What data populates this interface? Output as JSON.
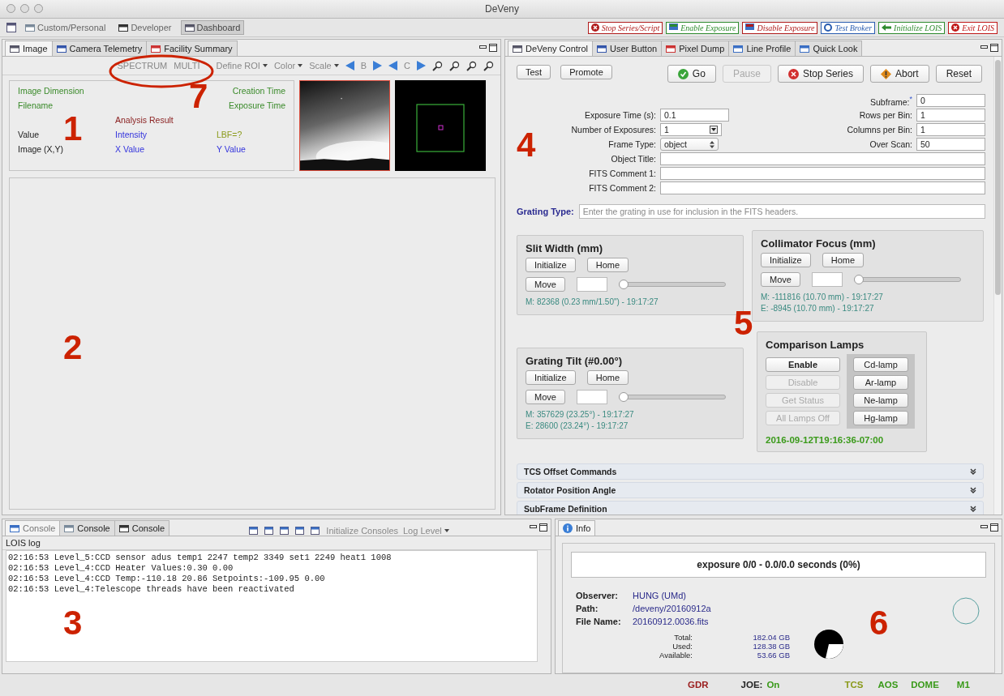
{
  "window": {
    "title": "DeVeny"
  },
  "perspectives": [
    {
      "label": "Custom/Personal",
      "selected": false
    },
    {
      "label": "Developer",
      "selected": false
    },
    {
      "label": "Dashboard",
      "selected": true
    }
  ],
  "command_buttons": [
    {
      "label": "Stop Series/Script",
      "color": "#b01c1c",
      "kind": "stop"
    },
    {
      "label": "Enable Exposure",
      "color": "#2e8b2e",
      "kind": "enable"
    },
    {
      "label": "Disable Exposure",
      "color": "#b01c1c",
      "kind": "disable"
    },
    {
      "label": "Test Broker",
      "color": "#2a5db0",
      "kind": "broker"
    },
    {
      "label": "Initialize LOIS",
      "color": "#2e8b2e",
      "kind": "init"
    },
    {
      "label": "Exit LOIS",
      "color": "#c01818",
      "kind": "exit"
    }
  ],
  "image_panel": {
    "tabs": [
      {
        "label": "Image",
        "selected": true
      },
      {
        "label": "Camera Telemetry",
        "selected": false
      },
      {
        "label": "Facility Summary",
        "selected": false
      }
    ],
    "tools": [
      {
        "label": "SPECTRUM",
        "kind": "text"
      },
      {
        "label": "MULTI",
        "kind": "text"
      },
      {
        "label": "Define ROI",
        "kind": "menu"
      },
      {
        "label": "Color",
        "kind": "menu"
      },
      {
        "label": "Scale",
        "kind": "menu"
      },
      {
        "label": "B",
        "kind": "stepper"
      },
      {
        "label": "C",
        "kind": "stepper"
      }
    ],
    "info": [
      {
        "text": "Image Dimension",
        "color": "#3a8a2a"
      },
      {
        "text": "Creation Time",
        "color": "#3a8a2a"
      },
      {
        "text": "Filename",
        "color": "#3a8a2a"
      },
      {
        "text": "Exposure Time",
        "color": "#3a8a2a"
      },
      {
        "text": "Analysis Result",
        "color": "#8b2222"
      },
      {
        "text": "Value"
      },
      {
        "text": "Intensity",
        "color": "#3333dd"
      },
      {
        "text": "LBF=?",
        "color": "#8a9a1a"
      },
      {
        "text": "Image (X,Y)"
      },
      {
        "text": "X Value",
        "color": "#3333dd"
      },
      {
        "text": "Y Value",
        "color": "#3333dd"
      }
    ]
  },
  "control_panel": {
    "tabs": [
      {
        "label": "DeVeny Control",
        "selected": true
      },
      {
        "label": "User Button",
        "selected": false
      },
      {
        "label": "Pixel Dump",
        "selected": false
      },
      {
        "label": "Line Profile",
        "selected": false
      },
      {
        "label": "Quick Look",
        "selected": false
      }
    ],
    "left_buttons": [
      {
        "label": "Test",
        "disabled": false
      },
      {
        "label": "Promote",
        "disabled": false
      }
    ],
    "action_buttons": [
      {
        "label": "Go",
        "kind": "go",
        "disabled": false
      },
      {
        "label": "Pause",
        "kind": "plain",
        "disabled": true
      },
      {
        "label": "Stop Series",
        "kind": "stop",
        "disabled": false
      },
      {
        "label": "Abort",
        "kind": "abort",
        "disabled": false
      },
      {
        "label": "Reset",
        "kind": "plain",
        "disabled": false
      }
    ],
    "fields_left": [
      {
        "label": "Exposure Time (s):",
        "value": "0.1",
        "kind": "text"
      },
      {
        "label": "Number of Exposures:",
        "value": "1",
        "kind": "combo"
      },
      {
        "label": "Frame Type:",
        "value": "object",
        "kind": "select"
      }
    ],
    "fields_right": [
      {
        "label": "Subframe:",
        "mark": "*",
        "value": "0"
      },
      {
        "label": "Rows per Bin:",
        "value": "1"
      },
      {
        "label": "Columns per Bin:",
        "value": "1"
      },
      {
        "label": "Over Scan:",
        "value": "50"
      }
    ],
    "fields_wide": [
      {
        "label": "Object Title:"
      },
      {
        "label": "FITS Comment 1:"
      },
      {
        "label": "FITS Comment 2:"
      }
    ],
    "grating_type": {
      "label": "Grating Type:",
      "placeholder": "Enter the grating in use for inclusion in the FITS headers."
    },
    "stages": [
      {
        "title": "Slit Width (mm)",
        "buttons": [
          "Initialize",
          "Home",
          "Move"
        ],
        "level": 0,
        "readings": [
          "M: 82368 (0.23 mm/1.50\") - 19:17:27"
        ]
      },
      {
        "title": "Grating Tilt (#0.00°)",
        "buttons": [
          "Initialize",
          "Home",
          "Move"
        ],
        "level": 0,
        "readings": [
          "M: 357629 (23.25°) - 19:17:27",
          "E: 28600 (23.24°) - 19:17:27"
        ]
      },
      {
        "title": "Collimator Focus (mm)",
        "buttons": [
          "Initialize",
          "Home",
          "Move"
        ],
        "level": 0,
        "readings": [
          "M: -111816 (10.70 mm) - 19:17:27",
          "E: -8945 (10.70 mm) - 19:17:27"
        ]
      }
    ],
    "lamps": {
      "title": "Comparison Lamps",
      "controls": [
        {
          "label": "Enable",
          "disabled": false
        },
        {
          "label": "Disable",
          "disabled": true
        },
        {
          "label": "Get Status",
          "disabled": true
        },
        {
          "label": "All Lamps Off",
          "disabled": true
        }
      ],
      "lamps": [
        "Cd-lamp",
        "Ar-lamp",
        "Ne-lamp",
        "Hg-lamp"
      ],
      "timestamp": "2016-09-12T19:16:36-07:00"
    },
    "sections": [
      {
        "title": "TCS Offset Commands",
        "expanded": false
      },
      {
        "title": "Rotator Position Angle",
        "expanded": false
      },
      {
        "title": "SubFrame Definition",
        "expanded": false
      }
    ]
  },
  "console_panel": {
    "tabs": [
      {
        "label": "Console",
        "selected": true
      },
      {
        "label": "Console",
        "selected": false
      },
      {
        "label": "Console",
        "selected": false
      }
    ],
    "tools": [
      {
        "label": "Initialize Consoles",
        "kind": "text"
      },
      {
        "label": "Log Level",
        "kind": "menu"
      }
    ],
    "log_title": "LOIS log",
    "lines": [
      "02:16:53 Level_5:CCD sensor adus temp1 2247 temp2 3349 set1 2249 heat1 1008",
      "02:16:53 Level_4:CCD Heater Values:0.30 0.00",
      "02:16:53 Level_4:CCD Temp:-110.18 20.86 Setpoints:-109.95 0.00",
      "02:16:53 Level_4:Telescope threads have been reactivated"
    ]
  },
  "info_panel": {
    "tabs": [
      {
        "label": "Info",
        "selected": true
      }
    ],
    "progress": "exposure 0/0 - 0.0/0.0 seconds (0%)",
    "details": [
      {
        "label": "Observer:",
        "value": "HUNG (UMd)"
      },
      {
        "label": "Path:",
        "value": "/deveny/20160912a"
      },
      {
        "label": "File Name:",
        "value": "20160912.0036.fits"
      }
    ],
    "disk": [
      {
        "label": "Total:",
        "value": "182.04 GB"
      },
      {
        "label": "Used:",
        "value": "128.38 GB"
      },
      {
        "label": "Available:",
        "value": "53.66 GB"
      }
    ]
  },
  "status_bar": [
    {
      "label": "GDR",
      "color": "#9a1c1c"
    },
    {
      "label": "JOE:",
      "color": "#222222"
    },
    {
      "label": "On",
      "color": "#3a9a1a"
    },
    {
      "label": "TCS",
      "color": "#8a9a1a"
    },
    {
      "label": "AOS",
      "color": "#3a9a1a"
    },
    {
      "label": "DOME",
      "color": "#3a9a1a"
    },
    {
      "label": "M1",
      "color": "#3a9a1a"
    }
  ],
  "annotations": [
    "1",
    "2",
    "3",
    "4",
    "5",
    "6",
    "7"
  ]
}
